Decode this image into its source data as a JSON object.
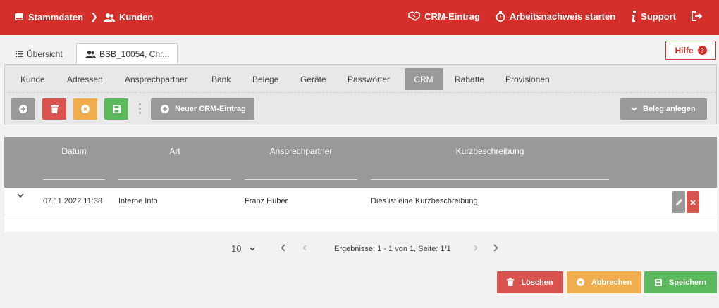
{
  "breadcrumb": {
    "home": "Stammdaten",
    "current": "Kunden"
  },
  "topnav": {
    "crm": "CRM-Eintrag",
    "work": "Arbeitsnachweis starten",
    "support": "Support"
  },
  "tabs": {
    "overview": "Übersicht",
    "customer": "BSB_10054, Chr..."
  },
  "help": {
    "label": "Hilfe",
    "mark": "?"
  },
  "subnav": [
    "Kunde",
    "Adressen",
    "Ansprechpartner",
    "Bank",
    "Belege",
    "Geräte",
    "Passwörter",
    "CRM",
    "Rabatte",
    "Provisionen"
  ],
  "subnav_active": "CRM",
  "toolbar": {
    "new_crm": "Neuer CRM-Eintrag",
    "beleg": "Beleg anlegen"
  },
  "table": {
    "columns": [
      "Datum",
      "Art",
      "Ansprechpartner",
      "Kurzbeschreibung"
    ],
    "rows": [
      {
        "datum": "07.11.2022 11:38",
        "art": "Interne Info",
        "ansprechpartner": "Franz Huber",
        "kurzbeschreibung": "Dies ist eine Kurzbeschreibung"
      }
    ]
  },
  "pager": {
    "page_size": "10",
    "info": "Ergebnisse: 1 - 1 von 1, Seite: 1/1"
  },
  "actions": {
    "delete": "Löschen",
    "cancel": "Abbrechen",
    "save": "Speichern"
  },
  "colors": {
    "brand": "#d42f2a",
    "grey": "#999999",
    "red": "#d9534f",
    "orange": "#f0ad4e",
    "green": "#5cb85c"
  }
}
